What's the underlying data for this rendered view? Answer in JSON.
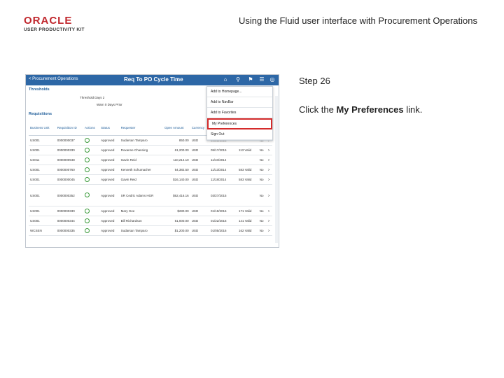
{
  "logo": {
    "brand": "ORACLE",
    "product": "USER PRODUCTIVITY KIT"
  },
  "header": {
    "title": "Using the Fluid user interface with Procurement Operations"
  },
  "app": {
    "back_label": "< Procurement Operations",
    "title": "Req To PO Cycle Time",
    "section_thresholds": "Thresholds",
    "threshold_days": "Threshold Days 2",
    "warn_days": "Warn 0 Days Prior",
    "section_requisitions": "Requisitions",
    "columns": [
      "Business Unit",
      "Requisition ID",
      "Actions",
      "Status",
      "Requester",
      "Open Amount",
      "Currency",
      "Approval Date",
      "Response",
      "",
      ""
    ],
    "rows": [
      {
        "bu": "US001",
        "id": "0000000037",
        "status": "Approved",
        "req": "Sudarsan Tamparo",
        "amt": "850.00",
        "cur": "USD",
        "date": "04/23/2015",
        "resp": "",
        "v": "No",
        "arrow": ">"
      },
      {
        "bu": "US001",
        "id": "0000000330",
        "status": "Approved",
        "req": "Roxanne Channing",
        "amt": "61,200.00",
        "cur": "USD",
        "date": "05/17/2015",
        "resp": "113 Valid",
        "v": "No",
        "arrow": ">"
      },
      {
        "bu": "US011",
        "id": "0000000948",
        "status": "Approved",
        "req": "Gavin Reid",
        "amt": "110,214.10",
        "cur": "USD",
        "date": "11/10/2014",
        "resp": "",
        "v": "No",
        "arrow": ">"
      },
      {
        "bu": "US001",
        "id": "0000000760",
        "status": "Approved",
        "req": "Kenneth Schumacher",
        "amt": "54,382.50",
        "cur": "USD",
        "date": "11/13/2014",
        "resp": "583 Valid",
        "v": "No",
        "arrow": ">"
      },
      {
        "bu": "US001",
        "id": "0000000045",
        "status": "Approved",
        "req": "Gavin Reid",
        "amt": "$16,140.00",
        "cur": "USD",
        "date": "11/18/2014",
        "resp": "583 Valid",
        "v": "No",
        "arrow": ">"
      },
      {
        "bu": "US001",
        "id": "0000000352",
        "status": "Approved",
        "req": "SR Cedric Adams HGR",
        "amt": "$62,416.16",
        "cur": "USD",
        "date": "03/27/2015",
        "resp": "",
        "v": "No",
        "arrow": ">"
      },
      {
        "bu": "US001",
        "id": "0000000330",
        "status": "Approved",
        "req": "Mary Gee",
        "amt": "$280.00",
        "cur": "USD",
        "date": "01/19/2016",
        "resp": "171 Valid",
        "v": "No",
        "arrow": ">"
      },
      {
        "bu": "US001",
        "id": "0000000344",
        "status": "Approved",
        "req": "Bill Richardson",
        "amt": "51,000.00",
        "cur": "USD",
        "date": "01/22/2016",
        "resp": "141 Valid",
        "v": "No",
        "arrow": ">"
      },
      {
        "bu": "WCSEN",
        "id": "0000000335",
        "status": "Approved",
        "req": "Sudarsan Tamparo",
        "amt": "$1,200.00",
        "cur": "USD",
        "date": "01/05/2016",
        "resp": "162 Valid",
        "v": "No",
        "arrow": ">"
      }
    ],
    "menu": [
      "Add to Homepage...",
      "Add to NavBar",
      "Add to Favorites",
      "My Preferences",
      "Sign Out"
    ]
  },
  "step": {
    "label": "Step 26"
  },
  "instruction": {
    "pre": "Click the ",
    "link": "My Preferences",
    "post": " link."
  },
  "colors": {
    "brand_red": "#c0272d",
    "bar_blue": "#2d67a6",
    "highlight": "#d42b2b"
  }
}
